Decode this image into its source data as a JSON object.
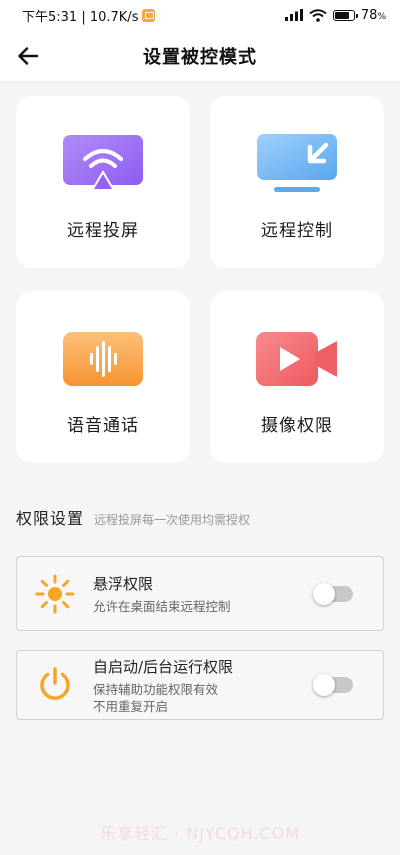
{
  "status_bar": {
    "time_speed": "下午5:31 | 10.7K/s",
    "battery": "78",
    "battery_unit": "%",
    "icons": [
      "app-notification-icon",
      "signal-icon",
      "wifi-icon",
      "battery-icon"
    ]
  },
  "header": {
    "title": "设置被控模式",
    "back_icon": "arrow-left-icon"
  },
  "cards": [
    {
      "label": "远程投屏",
      "icon": "screen-cast-icon",
      "color": "#9b6cf5"
    },
    {
      "label": "远程控制",
      "icon": "remote-control-monitor-icon",
      "color": "#5aa9f2"
    },
    {
      "label": "语音通话",
      "icon": "voice-wave-icon",
      "color": "#f79d3a"
    },
    {
      "label": "摄像权限",
      "icon": "video-camera-icon",
      "color": "#f0646a"
    }
  ],
  "permissions": {
    "title": "权限设置",
    "subtitle": "远程投屏每一次使用均需授权",
    "items": [
      {
        "name": "悬浮权限",
        "desc_line1": "允许在桌面结束远程控制",
        "desc_line2": "",
        "icon": "sun-icon",
        "enabled": false
      },
      {
        "name": "自启动/后台运行权限",
        "desc_line1": "保持辅助功能权限有效",
        "desc_line2": "不用重复开启",
        "icon": "power-icon",
        "enabled": false
      }
    ]
  },
  "colors": {
    "accent_orange": "#f5a623",
    "background": "#f5f5f7"
  },
  "watermark": "乐享轻汇 · NJYCQH.COM"
}
